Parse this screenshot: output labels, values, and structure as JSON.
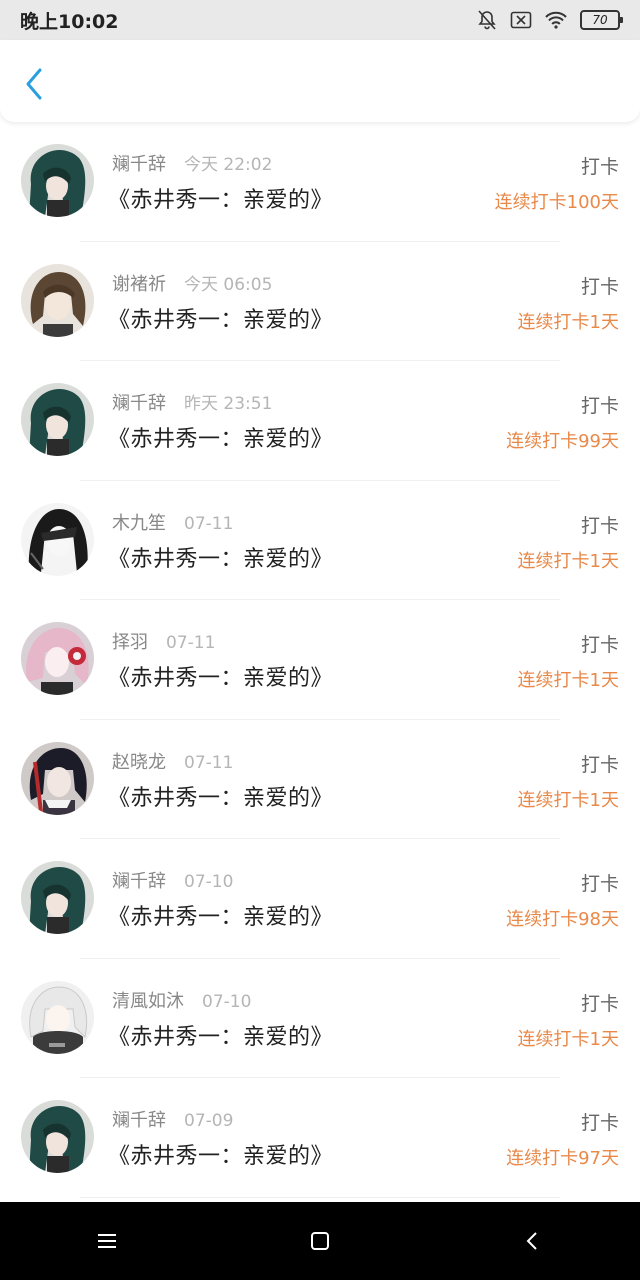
{
  "status_bar": {
    "time": "晚上10:02",
    "battery": "70",
    "icons": [
      "bell-off-icon",
      "sim-off-icon",
      "wifi-icon",
      "battery-icon"
    ]
  },
  "header": {
    "back_icon": "chevron-left-icon",
    "accent_color": "#2a9fe0"
  },
  "checkins": [
    {
      "name": "斓千辞",
      "time": "今天 22:02",
      "title": "《赤井秀一：亲爱的》",
      "label": "打卡",
      "streak": "连续打卡100天",
      "avatar": "avatar-green-hair"
    },
    {
      "name": "谢褚祈",
      "time": "今天 06:05",
      "title": "《赤井秀一：亲爱的》",
      "label": "打卡",
      "streak": "连续打卡1天",
      "avatar": "avatar-brown-hair"
    },
    {
      "name": "斓千辞",
      "time": "昨天 23:51",
      "title": "《赤井秀一：亲爱的》",
      "label": "打卡",
      "streak": "连续打卡99天",
      "avatar": "avatar-green-hair"
    },
    {
      "name": "木九笙",
      "time": "07-11",
      "title": "《赤井秀一：亲爱的》",
      "label": "打卡",
      "streak": "连续打卡1天",
      "avatar": "avatar-monochrome"
    },
    {
      "name": "择羽",
      "time": "07-11",
      "title": "《赤井秀一：亲爱的》",
      "label": "打卡",
      "streak": "连续打卡1天",
      "avatar": "avatar-pink-hair"
    },
    {
      "name": "赵晓龙",
      "time": "07-11",
      "title": "《赤井秀一：亲爱的》",
      "label": "打卡",
      "streak": "连续打卡1天",
      "avatar": "avatar-dark-hair"
    },
    {
      "name": "斓千辞",
      "time": "07-10",
      "title": "《赤井秀一：亲爱的》",
      "label": "打卡",
      "streak": "连续打卡98天",
      "avatar": "avatar-green-hair"
    },
    {
      "name": "清風如沐",
      "time": "07-10",
      "title": "《赤井秀一：亲爱的》",
      "label": "打卡",
      "streak": "连续打卡1天",
      "avatar": "avatar-white-hair"
    },
    {
      "name": "斓千辞",
      "time": "07-09",
      "title": "《赤井秀一：亲爱的》",
      "label": "打卡",
      "streak": "连续打卡97天",
      "avatar": "avatar-green-hair"
    }
  ],
  "colors": {
    "streak": "#e8894a",
    "name": "#888888",
    "time": "#b5b5b5"
  },
  "navigation_bar": {
    "buttons": [
      "menu-icon",
      "home-icon",
      "back-icon"
    ]
  }
}
